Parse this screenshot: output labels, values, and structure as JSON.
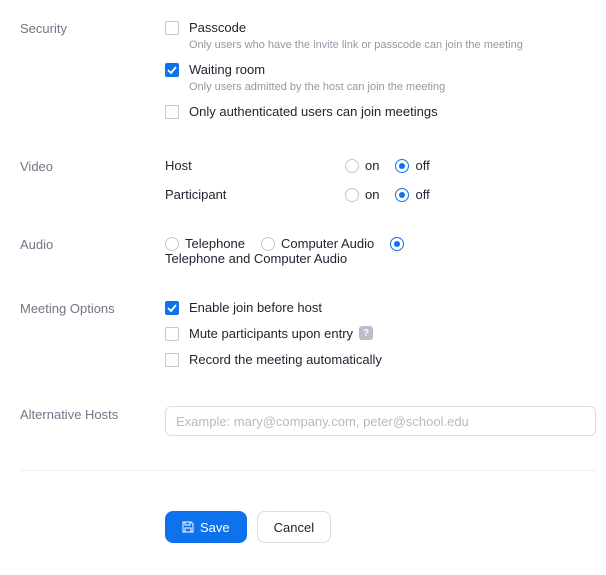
{
  "security": {
    "label": "Security",
    "passcode": {
      "label": "Passcode",
      "checked": false,
      "desc": "Only users who have the invite link or passcode can join the meeting"
    },
    "waiting_room": {
      "label": "Waiting room",
      "checked": true,
      "desc": "Only users admitted by the host can join the meeting"
    },
    "authenticated": {
      "label": "Only authenticated users can join meetings",
      "checked": false
    }
  },
  "video": {
    "label": "Video",
    "host_label": "Host",
    "participant_label": "Participant",
    "on_label": "on",
    "off_label": "off",
    "host_value": "off",
    "participant_value": "off"
  },
  "audio": {
    "label": "Audio",
    "telephone": "Telephone",
    "computer": "Computer Audio",
    "both": "Telephone and Computer Audio",
    "value": "both"
  },
  "meeting_options": {
    "label": "Meeting Options",
    "join_before": {
      "label": "Enable join before host",
      "checked": true
    },
    "mute_entry": {
      "label": "Mute participants upon entry",
      "checked": false
    },
    "record_auto": {
      "label": "Record the meeting automatically",
      "checked": false
    }
  },
  "alt_hosts": {
    "label": "Alternative Hosts",
    "placeholder": "Example: mary@company.com, peter@school.edu",
    "value": ""
  },
  "buttons": {
    "save": "Save",
    "cancel": "Cancel"
  }
}
